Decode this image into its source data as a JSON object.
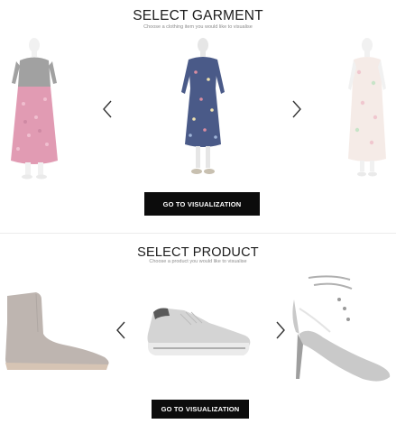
{
  "garment_section": {
    "title": "SELECT GARMENT",
    "subtitle": "Choose a clothing item you would like to visualise",
    "cta_label": "GO TO VISUALIZATION",
    "items": [
      {
        "name": "pink-floral-skirt-outfit",
        "state": "previous",
        "colors": {
          "top": "#555555",
          "skirt": "#c94a76"
        }
      },
      {
        "name": "blue-floral-wrap-dress",
        "state": "selected",
        "colors": {
          "dress": "#4a5a88"
        }
      },
      {
        "name": "pastel-floral-dress",
        "state": "next",
        "colors": {
          "dress": "#eedcd4"
        }
      }
    ]
  },
  "product_section": {
    "title": "SELECT PRODUCT",
    "subtitle": "Choose a product you would like to visualise",
    "cta_label": "GO TO VISUALIZATION",
    "items": [
      {
        "name": "taupe-ankle-boot",
        "state": "previous",
        "colors": {
          "shoe": "#8a7a70"
        }
      },
      {
        "name": "grey-running-sneaker",
        "state": "selected",
        "colors": {
          "shoe": "#d4d4d4"
        }
      },
      {
        "name": "silver-stiletto-pump",
        "state": "next",
        "colors": {
          "shoe": "#c9c9c9"
        }
      }
    ]
  },
  "colors": {
    "cta_background": "#0c0c0c",
    "cta_text": "#ffffff",
    "arrow": "#333333"
  },
  "icons": {
    "prev": "chevron-left-icon",
    "next": "chevron-right-icon"
  }
}
